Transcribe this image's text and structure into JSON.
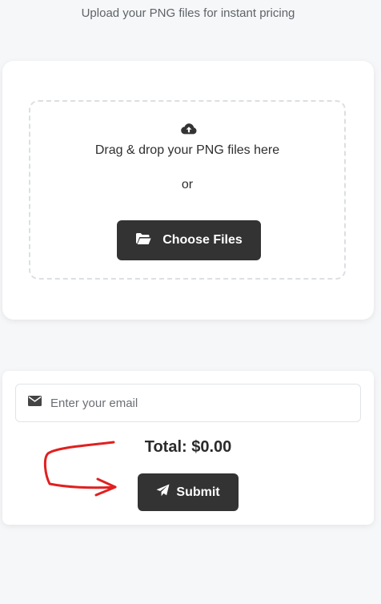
{
  "header": {
    "subtitle": "Upload your PNG files for instant pricing"
  },
  "upload": {
    "icon": "cloud-upload-icon",
    "drop_text": "Drag & drop your PNG files here",
    "or_text": "or",
    "choose_button_label": "Choose Files",
    "choose_button_icon": "folder-open-icon"
  },
  "order": {
    "email_icon": "envelope-icon",
    "email_placeholder": "Enter your email",
    "email_value": "",
    "total_label": "Total: $0.00",
    "submit_label": "Submit",
    "submit_icon": "paper-plane-icon"
  },
  "colors": {
    "page_background": "#f6f7f9",
    "button_background": "#333333",
    "annotation_red": "#e02020"
  }
}
